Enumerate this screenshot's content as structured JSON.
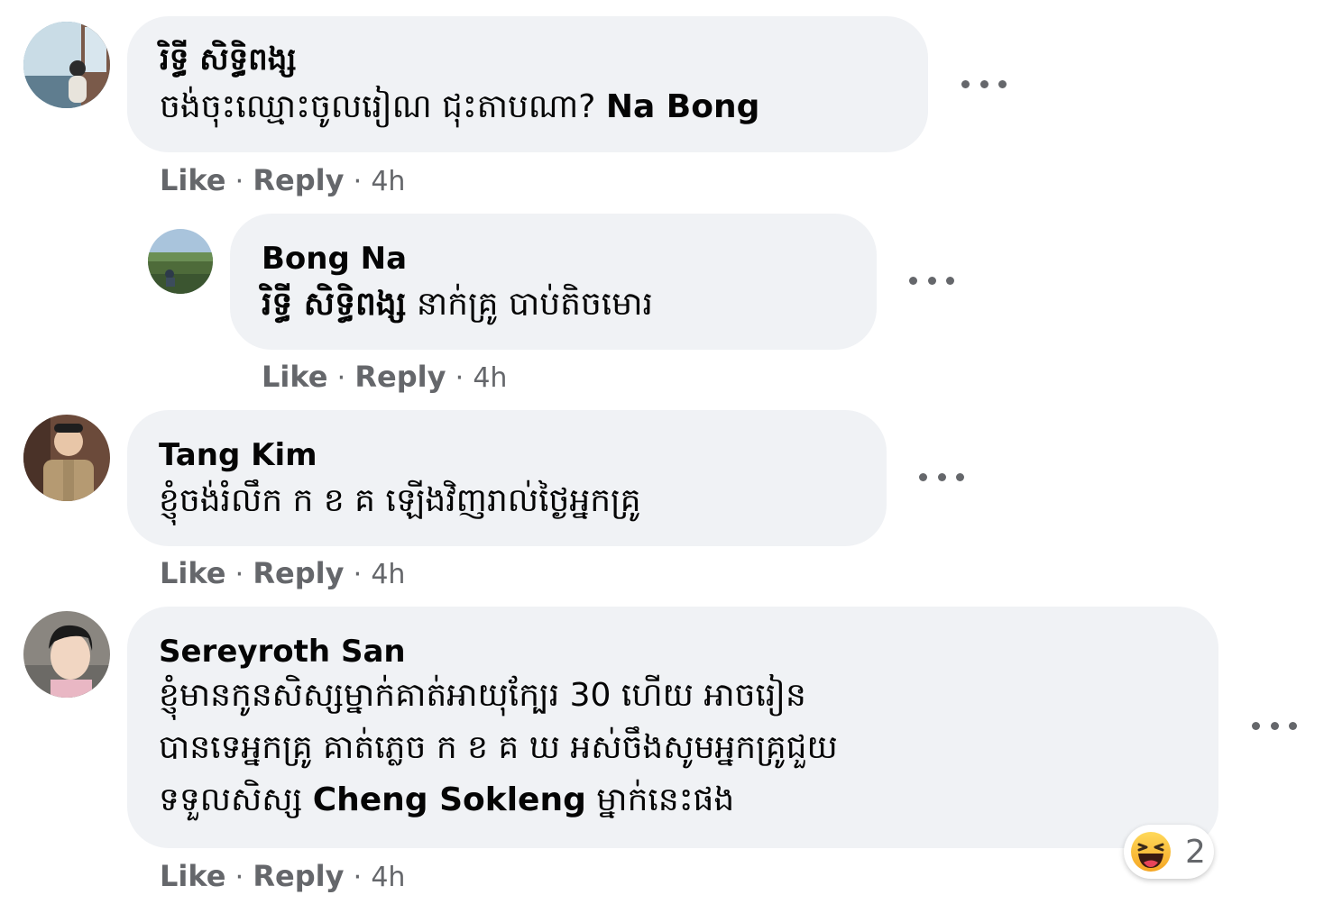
{
  "comments": [
    {
      "author": "រិទ្ធី សិទ្ធិពង្ស",
      "lines": [
        {
          "text": "ចង់ចុះឈ្មោះចូលរៀណ ជុះតាបណា? ",
          "mention": "Na Bong",
          "after": ""
        }
      ],
      "like_label": "Like",
      "reply_label": "Reply",
      "separator": "·",
      "time": "4h"
    },
    {
      "author": "Bong Na",
      "lines": [
        {
          "text": "",
          "mention": "រិទ្ធី សិទ្ធិពង្ស",
          "after": " នាក់គ្រូ បាប់តិចមោរ"
        }
      ],
      "like_label": "Like",
      "reply_label": "Reply",
      "separator": "·",
      "time": "4h"
    },
    {
      "author": "Tang Kim",
      "lines": [
        {
          "text": "ខ្ញុំចង់រំលឹក ក ខ គ ឡើងវិញរាល់ថ្ងៃអ្នកគ្រូ",
          "mention": "",
          "after": ""
        }
      ],
      "like_label": "Like",
      "reply_label": "Reply",
      "separator": "·",
      "time": "4h"
    },
    {
      "author": "Sereyroth San",
      "lines": [
        {
          "text": "ខ្ញុំមានកូនសិស្សម្នាក់គាត់អាយុក្បែរ 30 ហើយ អាចរៀន",
          "mention": "",
          "after": ""
        },
        {
          "text": "បានទេអ្នកគ្រូ គាត់ភ្លេច ក ខ គ ឃ អស់ចឹងសូមអ្នកគ្រូជួយ",
          "mention": "",
          "after": ""
        },
        {
          "text": "ទទួលសិស្ស ",
          "mention": "Cheng Sokleng",
          "after": " ម្នាក់នេះផង"
        }
      ],
      "like_label": "Like",
      "reply_label": "Reply",
      "separator": "·",
      "time": "4h",
      "reaction": {
        "icon": "laughing-emoji-icon",
        "count": "2"
      }
    }
  ],
  "colors": {
    "bubble": "#f0f2f5",
    "meta": "#65676b",
    "text": "#050505"
  }
}
